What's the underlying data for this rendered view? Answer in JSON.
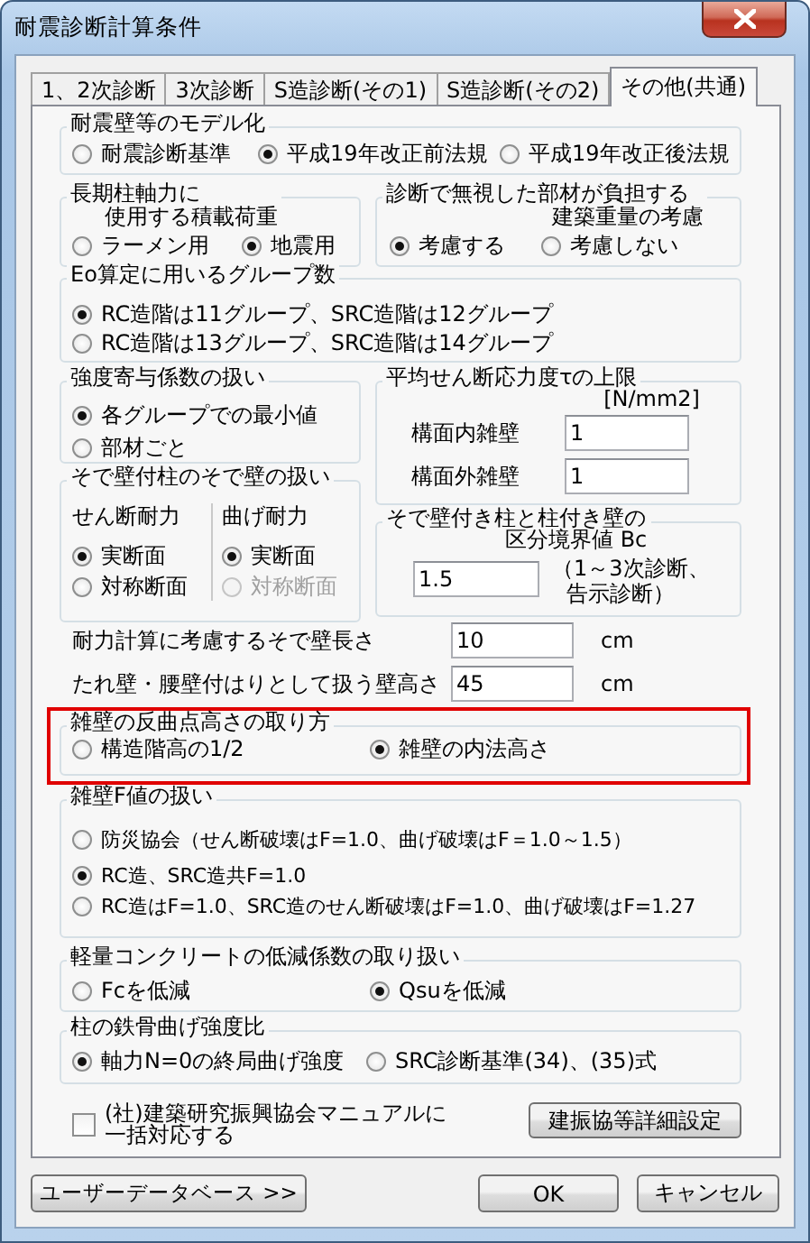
{
  "window": {
    "title": "耐震診断計算条件"
  },
  "tabs": [
    {
      "label": "1、2次診断",
      "selected": false
    },
    {
      "label": "3次診断",
      "selected": false
    },
    {
      "label": "S造診断(その1)",
      "selected": false
    },
    {
      "label": "S造診断(その2)",
      "selected": false
    },
    {
      "label": "その他(共通)",
      "selected": true
    }
  ],
  "wall_model": {
    "title": [
      "耐震壁等のモデル化"
    ],
    "options": [
      {
        "label": "耐震診断基準",
        "selected": false
      },
      {
        "label": "平成19年改正前法規",
        "selected": true
      },
      {
        "label": "平成19年改正後法規",
        "selected": false
      }
    ]
  },
  "live_load": {
    "title": [
      "長期柱軸力に",
      "使用する積載荷重"
    ],
    "options": [
      {
        "label": "ラーメン用",
        "selected": false
      },
      {
        "label": "地震用",
        "selected": true
      }
    ]
  },
  "ignored_weight": {
    "title": [
      "診断で無視した部材が負担する",
      "建築重量の考慮"
    ],
    "options": [
      {
        "label": "考慮する",
        "selected": true
      },
      {
        "label": "考慮しない",
        "selected": false
      }
    ]
  },
  "eo_groups": {
    "title": [
      "Eo算定に用いるグループ数"
    ],
    "options": [
      {
        "label": "RC造階は11グループ、SRC造階は12グループ",
        "selected": true
      },
      {
        "label": "RC造階は13グループ、SRC造階は14グループ",
        "selected": false
      }
    ]
  },
  "strength_factor": {
    "title": [
      "強度寄与係数の扱い"
    ],
    "options": [
      {
        "label": "各グループでの最小値",
        "selected": true
      },
      {
        "label": "部材ごと",
        "selected": false
      }
    ]
  },
  "shear_limit": {
    "title": "平均せん断応力度τの上限",
    "unit": "[N/mm2]",
    "fields": [
      {
        "label": "構面内雑壁",
        "value": "1"
      },
      {
        "label": "構面外雑壁",
        "value": "1"
      }
    ]
  },
  "wing_wall": {
    "title": "そで壁付柱のそで壁の扱い",
    "columns": [
      {
        "heading": "せん断耐力",
        "options": [
          {
            "label": "実断面",
            "selected": true,
            "disabled": false
          },
          {
            "label": "対称断面",
            "selected": false,
            "disabled": false
          }
        ]
      },
      {
        "heading": "曲げ耐力",
        "options": [
          {
            "label": "実断面",
            "selected": true,
            "disabled": false
          },
          {
            "label": "対称断面",
            "selected": false,
            "disabled": true
          }
        ]
      }
    ]
  },
  "boundary": {
    "title": [
      "そで壁付き柱と柱付き壁の",
      "区分境界値 Bc"
    ],
    "value": "1.5",
    "note": [
      "（1～3次診断、",
      "告示診断）"
    ]
  },
  "lengths": [
    {
      "label": "耐力計算に考慮するそで壁長さ",
      "value": "10",
      "unit": "cm"
    },
    {
      "label": "たれ壁・腰壁付はりとして扱う壁高さ",
      "value": "45",
      "unit": "cm"
    }
  ],
  "inflection": {
    "title": [
      "雑壁の反曲点高さの取り方"
    ],
    "highlighted": true,
    "options": [
      {
        "label": "構造階高の1/2",
        "selected": false
      },
      {
        "label": "雑壁の内法高さ",
        "selected": true
      }
    ]
  },
  "f_value": {
    "title": [
      "雑壁F値の扱い"
    ],
    "options": [
      {
        "label": "防災協会（せん断破壊はF=1.0、曲げ破壊はF＝1.0～1.5）",
        "selected": false
      },
      {
        "label": "RC造、SRC造共F=1.0",
        "selected": true
      },
      {
        "label": "RC造はF=1.0、SRC造のせん断破壊はF=1.0、曲げ破壊はF=1.27",
        "selected": false
      }
    ]
  },
  "lightweight": {
    "title": [
      "軽量コンクリートの低減係数の取り扱い"
    ],
    "options": [
      {
        "label": "Fcを低減",
        "selected": false
      },
      {
        "label": "Qsuを低減",
        "selected": true
      }
    ]
  },
  "steel_ratio": {
    "title": [
      "柱の鉄骨曲げ強度比"
    ],
    "options": [
      {
        "label": "軸力N=0の終局曲げ強度",
        "selected": true
      },
      {
        "label": "SRC診断基準(34)、(35)式",
        "selected": false
      }
    ]
  },
  "manual": {
    "label": [
      "(社)建築研究振興協会マニュアルに",
      "一括対応する"
    ],
    "checked": false
  },
  "detail_button": "建振協等詳細設定",
  "buttons": [
    {
      "label": "ユーザーデータベース >>"
    },
    {
      "label": "OK"
    },
    {
      "label": "キャンセル"
    }
  ]
}
